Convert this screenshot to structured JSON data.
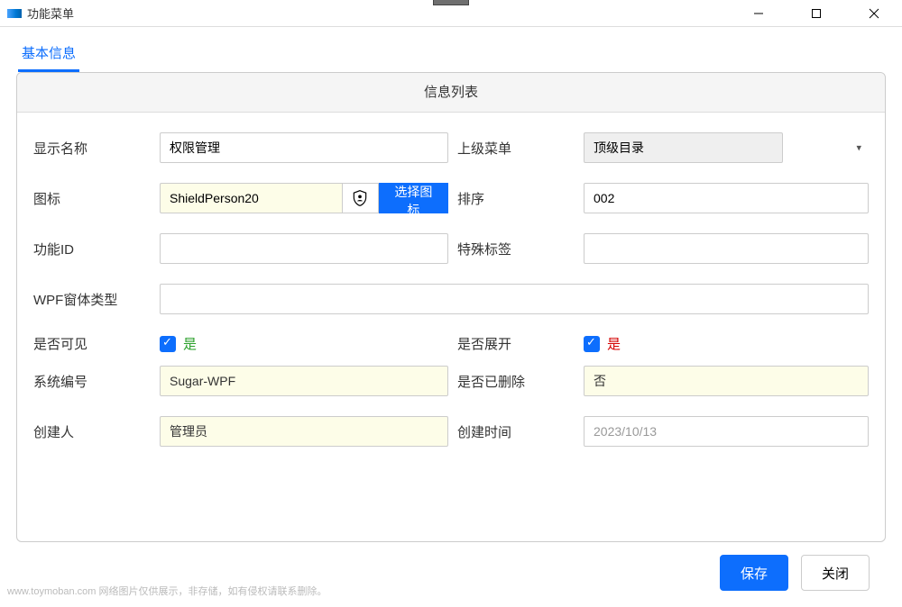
{
  "window": {
    "title": "功能菜单"
  },
  "tabs": {
    "basic_info": "基本信息"
  },
  "panel": {
    "header": "信息列表"
  },
  "labels": {
    "display_name": "显示名称",
    "parent_menu": "上级菜单",
    "icon": "图标",
    "sort": "排序",
    "function_id": "功能ID",
    "special_tag": "特殊标签",
    "wpf_form_type": "WPF窗体类型",
    "visible": "是否可见",
    "expanded": "是否展开",
    "system_code": "系统编号",
    "deleted": "是否已删除",
    "creator": "创建人",
    "created_at": "创建时间"
  },
  "values": {
    "display_name": "权限管理",
    "parent_menu": "顶级目录",
    "icon_name": "ShieldPerson20",
    "sort": "002",
    "function_id": "",
    "special_tag": "",
    "wpf_form_type": "",
    "visible_checked": true,
    "visible_text": "是",
    "expanded_checked": true,
    "expanded_text": "是",
    "system_code": "Sugar-WPF",
    "deleted": "否",
    "creator": "管理员",
    "created_at": "2023/10/13"
  },
  "buttons": {
    "choose_icon": "选择图标",
    "save": "保存",
    "close": "关闭"
  },
  "watermark": "www.toymoban.com 网络图片仅供展示，非存储，如有侵权请联系删除。"
}
